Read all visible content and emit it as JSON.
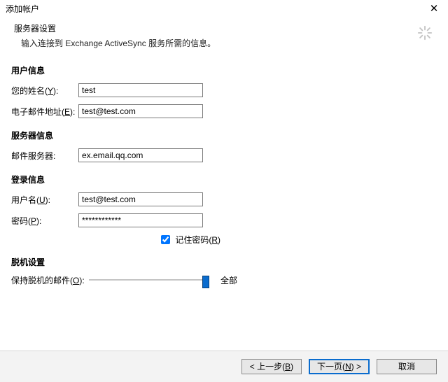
{
  "window": {
    "title": "添加帐户"
  },
  "header": {
    "title": "服务器设置",
    "sub": "输入连接到 Exchange ActiveSync 服务所需的信息。"
  },
  "sections": {
    "userinfo": {
      "title": "用户信息",
      "name": {
        "label": "您的姓名(",
        "hot": "Y",
        "after": "):",
        "value": "test"
      },
      "email": {
        "label": "电子邮件地址(",
        "hot": "E",
        "after": "):",
        "value": "test@test.com"
      }
    },
    "serverinfo": {
      "title": "服务器信息",
      "mailserver": {
        "label": "邮件服务器:",
        "value": "ex.email.qq.com"
      }
    },
    "login": {
      "title": "登录信息",
      "user": {
        "label": "用户名(",
        "hot": "U",
        "after": "):",
        "value": "test@test.com"
      },
      "pass": {
        "label": "密码(",
        "hot": "P",
        "after": "):",
        "value": "************"
      },
      "remember": {
        "label": "记住密码(",
        "hot": "R",
        "after": ")",
        "checked": true
      }
    },
    "offline": {
      "title": "脱机设置",
      "keep": {
        "label": "保持脱机的邮件(",
        "hot": "O",
        "after": "):",
        "value": "全部"
      }
    }
  },
  "buttons": {
    "back": {
      "pre": "< 上一步(",
      "hot": "B",
      "after": ")"
    },
    "next": {
      "pre": "下一页(",
      "hot": "N",
      "after": ") >"
    },
    "cancel": {
      "label": "取消"
    }
  }
}
